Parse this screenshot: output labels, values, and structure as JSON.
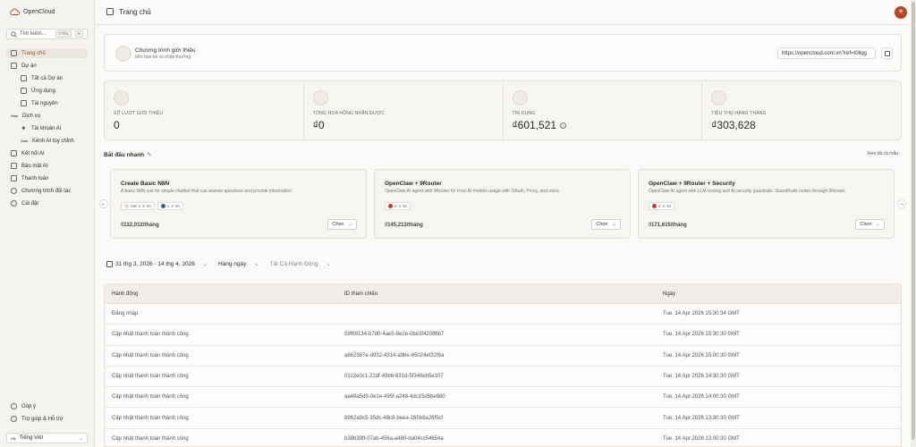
{
  "app": {
    "name": "OpenCloud",
    "page_title": "Trang chủ"
  },
  "search": {
    "placeholder": "Tìm kiếm...",
    "shortcut_ctrl": "CTRL",
    "shortcut_key": "K"
  },
  "sidebar": {
    "items": [
      {
        "label": "Trang chủ",
        "icon": "home-icon",
        "active": true
      },
      {
        "label": "Dự án",
        "icon": "folder-icon"
      },
      {
        "label": "Tất cả Dự án",
        "icon": "list-icon",
        "sub": true
      },
      {
        "label": "Ứng dụng",
        "icon": "grid-icon",
        "sub": true
      },
      {
        "label": "Tài nguyên",
        "icon": "database-icon",
        "sub": true
      },
      {
        "label": "Dịch vụ",
        "icon": "zalo-icon"
      },
      {
        "label": "Tài khoản AI",
        "icon": "sparkle-icon",
        "sub": true
      },
      {
        "label": "Kênh AI tùy chỉnh",
        "icon": "zalo-icon",
        "sub": true
      },
      {
        "label": "Kết nối AI",
        "icon": "link-icon"
      },
      {
        "label": "Bảo mật AI",
        "icon": "shield-icon"
      },
      {
        "label": "Thanh toán",
        "icon": "card-icon"
      },
      {
        "label": "Chương trình đối tác",
        "icon": "handshake-icon"
      },
      {
        "label": "Cài đặt",
        "icon": "gear-icon"
      }
    ],
    "footer": [
      {
        "label": "Góp ý",
        "icon": "chat-icon"
      },
      {
        "label": "Trợ giúp & Hỗ trợ",
        "icon": "help-icon"
      }
    ],
    "language": {
      "flag": "VN",
      "label": "Tiếng Việt"
    }
  },
  "referral": {
    "title": "Chương trình giới thiệu",
    "subtitle": "Mời bạn bè và nhận thưởng.",
    "url": "https://opencloud.com.vn?ref=t0llqg"
  },
  "stats": [
    {
      "label": "SỐ LƯỢT GIỚI THIỆU",
      "value": "0"
    },
    {
      "label": "TỔNG HOA HỒNG NHẬN ĐƯỢC",
      "value": "₫0"
    },
    {
      "label": "TÍN DỤNG",
      "value": "₫601,521",
      "info": "i"
    },
    {
      "label": "TIÊU THỤ HÀNG THÁNG",
      "value": "₫303,628"
    }
  ],
  "quick_start": {
    "title": "Bắt đầu nhanh",
    "view_all": "Xem tất cả mẫu",
    "templates": [
      {
        "name": "Create Basic N8N",
        "desc": "A basic N8N suit for simple chatbot that can answer questions and provide information.",
        "badges": [
          "n8n 1",
          "2",
          "20"
        ],
        "badges2": [
          "1",
          "2",
          "20"
        ],
        "price": "₫132,012/tháng",
        "choose": "Chọn"
      },
      {
        "name": "OpenClaw + 9Router",
        "desc": "OpenClaw AI agent with 9Router for Free AI models usage with OAuth, Proxy, and more.",
        "badges": [
          "2",
          "4",
          "40"
        ],
        "price": "₫145,213/tháng",
        "choose": "Chọn"
      },
      {
        "name": "OpenClaw + 9Router + Security",
        "desc": "OpenClaw AI agent with LLM routing and AI security guardrails. GuardRails routes through 9Router.",
        "badges": [
          "2",
          "4",
          "40"
        ],
        "price": "₫171,615/tháng",
        "choose": "Chọn"
      }
    ]
  },
  "filters": {
    "date_range": "31 thg 3, 2026 - 14 thg 4, 2026",
    "granularity": "Hàng ngày",
    "actions": "Tất Cả Hành Động"
  },
  "table": {
    "headers": [
      "Hành động",
      "ID tham chiếu",
      "Ngày"
    ],
    "rows": [
      [
        "Đăng nhập",
        "",
        "Tue, 14 Apr 2026 15:30:34 GMT"
      ],
      [
        "Cập nhật thanh toán thành công",
        "59f69134-b7d0-4ae5-8e2e-0be3f42086b7",
        "Tue, 14 Apr 2026 15:30:30 GMT"
      ],
      [
        "Cập nhật thanh toán thành công",
        "a662387e-d932-4314-a9be-65024ef32f6a",
        "Tue, 14 Apr 2026 15:00:30 GMT"
      ],
      [
        "Cập nhật thanh toán thành công",
        "01c2e0c1-22df-49b6-831d-5f346eb5e107",
        "Tue, 14 Apr 2026 14:30:30 GMT"
      ],
      [
        "Cập nhật thanh toán thành công",
        "aa48a5d9-0e1e-495f-a248-4dc15d5be8d0",
        "Tue, 14 Apr 2026 14:00:30 GMT"
      ],
      [
        "Cập nhật thanh toán thành công",
        "8962a9c5-35dc-48c9-beea-165b8a26f5cf",
        "Tue, 14 Apr 2026 13:30:30 GMT"
      ],
      [
        "Cập nhật thanh toán thành công",
        "b38b39ff-07ab-456a-a480-da04cc54654a",
        "Tue, 14 Apr 2026 13:00:30 GMT"
      ]
    ]
  },
  "colors": {
    "accent": "#b5482a",
    "active_bg": "#ebe6de"
  }
}
